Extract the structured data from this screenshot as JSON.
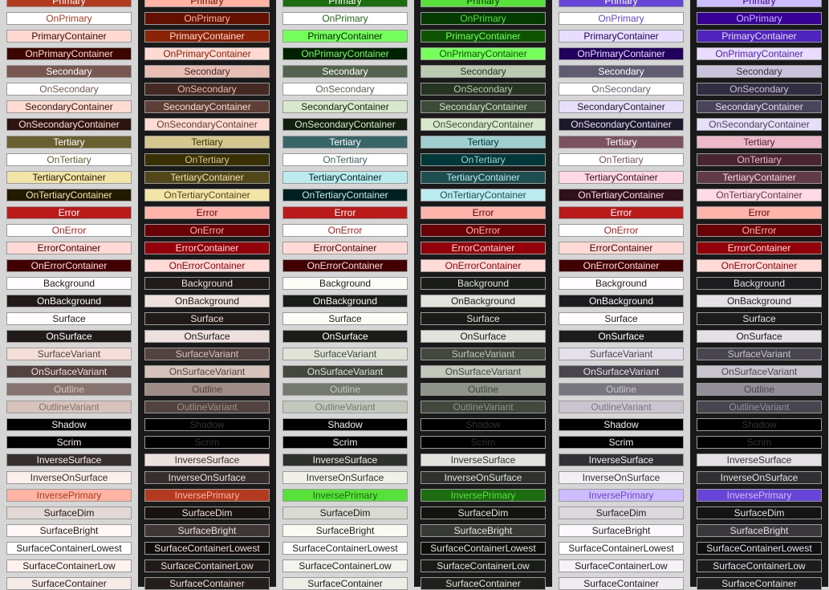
{
  "names": [
    "Primary",
    "OnPrimary",
    "PrimaryContainer",
    "OnPrimaryContainer",
    "Secondary",
    "OnSecondary",
    "SecondaryContainer",
    "OnSecondaryContainer",
    "Tertiary",
    "OnTertiary",
    "TertiaryContainer",
    "OnTertiaryContainer",
    "Error",
    "OnError",
    "ErrorContainer",
    "OnErrorContainer",
    "Background",
    "OnBackground",
    "Surface",
    "OnSurface",
    "SurfaceVariant",
    "OnSurfaceVariant",
    "Outline",
    "OutlineVariant",
    "Shadow",
    "Scrim",
    "InverseSurface",
    "InverseOnSurface",
    "InversePrimary",
    "SurfaceDim",
    "SurfaceBright",
    "SurfaceContainerLowest",
    "SurfaceContainerLow",
    "SurfaceContainer"
  ],
  "schemes": [
    {
      "theme": "light",
      "bg": "#d6d6d6",
      "colors": [
        "#b23a1e",
        "#ffffff",
        "#ffdad2",
        "#3d0700",
        "#77574f",
        "#ffffff",
        "#ffdad2",
        "#2c1510",
        "#6a5f2f",
        "#ffffff",
        "#f3e4a8",
        "#221b00",
        "#ba1a1a",
        "#ffffff",
        "#ffdad6",
        "#410002",
        "#fffbff",
        "#201a19",
        "#fffbff",
        "#201a19",
        "#f5ddd8",
        "#534340",
        "#85736f",
        "#d8c2bc",
        "#000000",
        "#000000",
        "#362f2d",
        "#fbeeeb",
        "#ffb4a3",
        "#e2d8d5",
        "#fff8f6",
        "#ffffff",
        "#fff1ee",
        "#f7ebe8"
      ]
    },
    {
      "theme": "dark",
      "bg": "#1a1a1a",
      "colors": [
        "#ffb4a3",
        "#631000",
        "#8b2307",
        "#ffdad2",
        "#e7bdb4",
        "#442a23",
        "#5d3f38",
        "#ffdad2",
        "#d6c78e",
        "#393005",
        "#51471a",
        "#f3e4a8",
        "#ffb4ab",
        "#690005",
        "#93000a",
        "#ffdad6",
        "#201a19",
        "#ede0dd",
        "#201a19",
        "#ede0dd",
        "#534340",
        "#d8c2bc",
        "#a08c87",
        "#534340",
        "#000000",
        "#000000",
        "#ede0dd",
        "#362f2d",
        "#b23a1e",
        "#181211",
        "#3f3735",
        "#130d0c",
        "#201a19",
        "#241e1d"
      ]
    },
    {
      "theme": "light",
      "bg": "#d6d6d6",
      "colors": [
        "#1b6d0f",
        "#ffffff",
        "#74ff5a",
        "#002200",
        "#54634d",
        "#ffffff",
        "#d7e8cc",
        "#121f0e",
        "#386668",
        "#ffffff",
        "#bbebee",
        "#002022",
        "#ba1a1a",
        "#ffffff",
        "#ffdad6",
        "#410002",
        "#fcfdf6",
        "#1a1c18",
        "#fcfdf6",
        "#1a1c18",
        "#dfe4d7",
        "#43483f",
        "#73796e",
        "#c3c8bc",
        "#000000",
        "#000000",
        "#2f312d",
        "#f1f1ea",
        "#58e13a",
        "#dadad3",
        "#f9faf2",
        "#ffffff",
        "#f3f4ed",
        "#eeeee7"
      ]
    },
    {
      "theme": "dark",
      "bg": "#1a1a1a",
      "colors": [
        "#58e13a",
        "#023a00",
        "#0d5300",
        "#74ff5a",
        "#bbcbb2",
        "#263422",
        "#3c4b37",
        "#d7e8cc",
        "#a0cfd2",
        "#003739",
        "#1e4e50",
        "#bbebee",
        "#ffb4ab",
        "#690005",
        "#93000a",
        "#ffdad6",
        "#1a1c18",
        "#e2e3dc",
        "#1a1c18",
        "#e2e3dc",
        "#43483f",
        "#c3c8bc",
        "#8d9387",
        "#43483f",
        "#000000",
        "#000000",
        "#e2e3dc",
        "#2f312d",
        "#1b6d0f",
        "#121410",
        "#383a35",
        "#0d0f0b",
        "#1a1c18",
        "#1e201c"
      ]
    },
    {
      "theme": "light",
      "bg": "#d6d6d6",
      "colors": [
        "#6745d6",
        "#ffffff",
        "#e8ddff",
        "#21005e",
        "#615b71",
        "#ffffff",
        "#e7dff9",
        "#1d192b",
        "#7d5260",
        "#ffffff",
        "#ffd9e3",
        "#31101d",
        "#ba1a1a",
        "#ffffff",
        "#ffdad6",
        "#410002",
        "#fffbff",
        "#1c1b1e",
        "#fffbff",
        "#1c1b1e",
        "#e6e0ec",
        "#48454e",
        "#79757f",
        "#cac4cf",
        "#000000",
        "#000000",
        "#313033",
        "#f4eff4",
        "#cdbdff",
        "#ddd8dd",
        "#fdf8fd",
        "#ffffff",
        "#f7f2f7",
        "#f1ecf1"
      ]
    },
    {
      "theme": "dark",
      "bg": "#1a1a1a",
      "colors": [
        "#cdbdff",
        "#370096",
        "#4f23bd",
        "#e8ddff",
        "#cbc3dc",
        "#332d41",
        "#4a4458",
        "#e7dff9",
        "#efb8c8",
        "#492532",
        "#633b48",
        "#ffd9e3",
        "#ffb4ab",
        "#690005",
        "#93000a",
        "#ffdad6",
        "#1c1b1e",
        "#e6e1e6",
        "#1c1b1e",
        "#e6e1e6",
        "#48454e",
        "#cac4cf",
        "#938f99",
        "#48454e",
        "#000000",
        "#000000",
        "#e6e1e6",
        "#313033",
        "#6745d6",
        "#141316",
        "#3a383c",
        "#0f0e11",
        "#1c1b1e",
        "#201f22"
      ]
    }
  ]
}
